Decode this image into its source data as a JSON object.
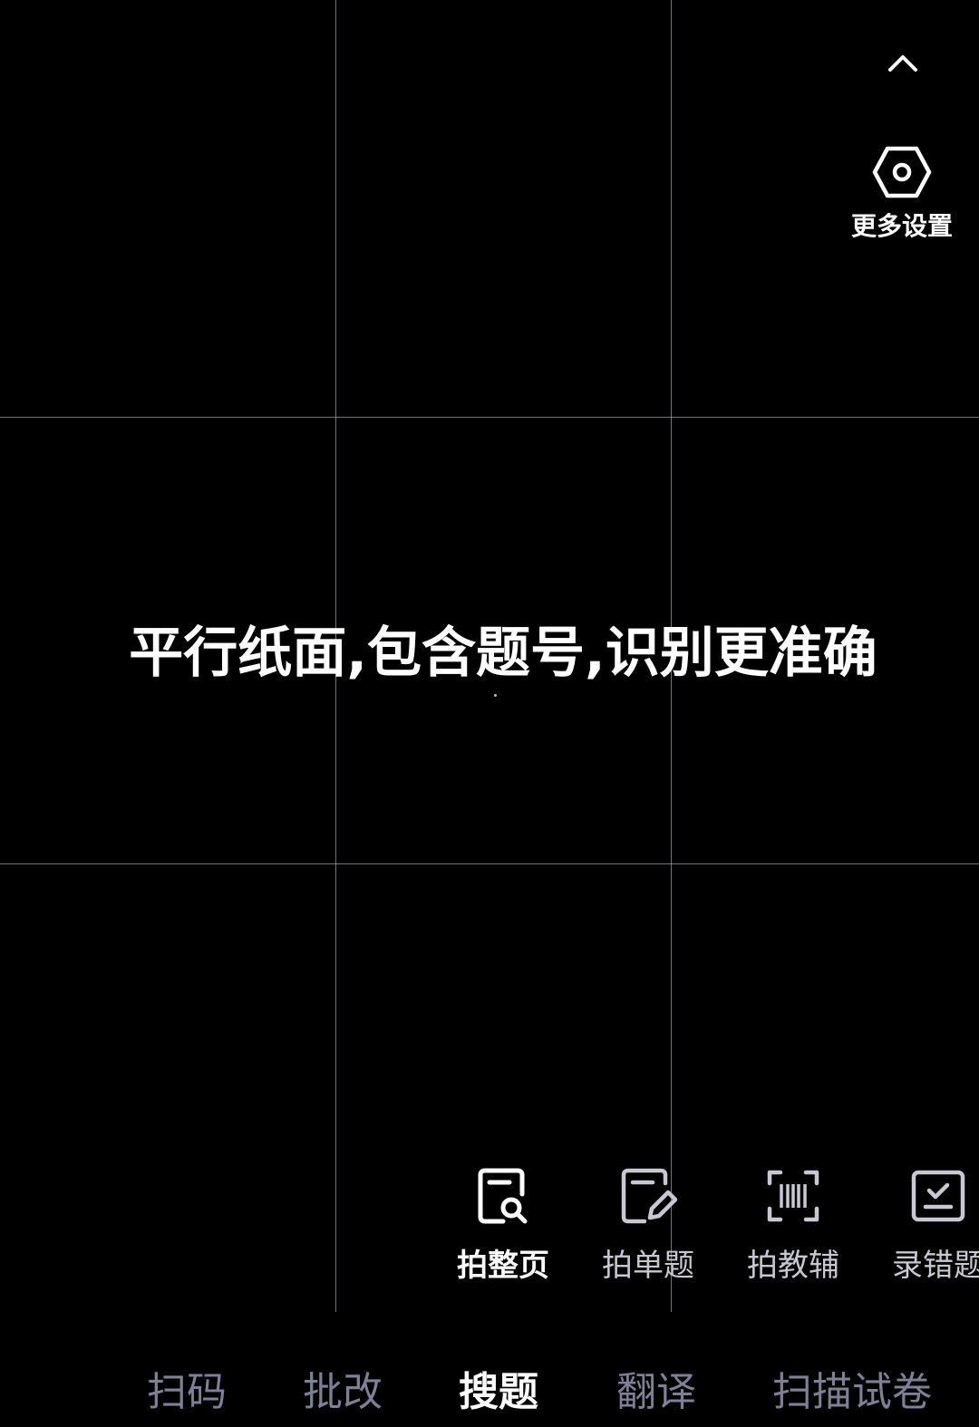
{
  "settings": {
    "label": "更多设置",
    "icon": "settings-hexagon-icon"
  },
  "collapse": {
    "icon": "chevron-up-icon"
  },
  "hint": {
    "text": "平行纸面,包含题号,识别更准确"
  },
  "modes": [
    {
      "label": "拍整页",
      "icon": "page-search-icon",
      "active": true
    },
    {
      "label": "拍单题",
      "icon": "page-edit-icon",
      "active": false
    },
    {
      "label": "拍教辅",
      "icon": "barcode-scan-icon",
      "active": false
    },
    {
      "label": "录错题",
      "icon": "page-check-icon",
      "active": false
    }
  ],
  "tabs": [
    {
      "label": "扫码",
      "active": false
    },
    {
      "label": "批改",
      "active": false
    },
    {
      "label": "搜题",
      "active": true
    },
    {
      "label": "翻译",
      "active": false
    },
    {
      "label": "扫描试卷",
      "active": false
    }
  ],
  "colors": {
    "background": "#000000",
    "active_text": "#ffffff",
    "inactive_mode_text": "#c8c8d2",
    "inactive_tab_text": "#7f7f96",
    "grid_line": "#cdcde6"
  }
}
